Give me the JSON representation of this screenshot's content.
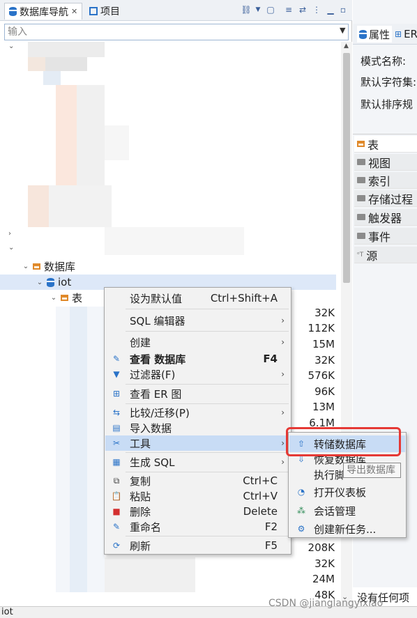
{
  "nav_tabs": {
    "navigator": "数据库导航",
    "projects": "项目"
  },
  "filter": {
    "placeholder": "输入"
  },
  "tree": {
    "databases_folder": "数据库",
    "db_name": "iot",
    "tables_folder": "表"
  },
  "sizes": [
    "32K",
    "112K",
    "15M",
    "32K",
    "576K",
    "96K",
    "13M",
    "6.1M",
    "208K",
    "32K",
    "24M",
    "48K"
  ],
  "right_panel": {
    "tab_properties": "属性",
    "tab_er": "ER",
    "schema_name_label": "模式名称:",
    "default_charset_label": "默认字符集:",
    "default_collation_label": "默认排序规",
    "categories": [
      "表",
      "视图",
      "索引",
      "存储过程",
      "触发器",
      "事件",
      "源"
    ],
    "empty_text": "没有任何项"
  },
  "context_menu": {
    "items": [
      {
        "label": "设为默认值",
        "shortcut": "Ctrl+Shift+A"
      },
      {
        "label": "SQL 编辑器",
        "submenu": true
      },
      {
        "label": "创建",
        "submenu": true
      },
      {
        "label": "查看 数据库",
        "shortcut": "F4"
      },
      {
        "label": "过滤器(F)",
        "submenu": true
      },
      {
        "label": "查看 ER 图"
      },
      {
        "label": "比较/迁移(P)",
        "submenu": true
      },
      {
        "label": "导入数据"
      },
      {
        "label": "工具",
        "submenu": true
      },
      {
        "label": "生成 SQL",
        "submenu": true
      },
      {
        "label": "复制",
        "shortcut": "Ctrl+C"
      },
      {
        "label": "粘贴",
        "shortcut": "Ctrl+V"
      },
      {
        "label": "删除",
        "shortcut": "Delete"
      },
      {
        "label": "重命名",
        "shortcut": "F2"
      },
      {
        "label": "刷新",
        "shortcut": "F5"
      }
    ]
  },
  "tools_submenu": {
    "items": [
      "转储数据库",
      "恢复数据库",
      "执行脚",
      "打开仪表板",
      "会话管理",
      "创建新任务..."
    ]
  },
  "tooltip": "导出数据库",
  "status_text": "iot",
  "watermark": "CSDN @jianglangyixiao",
  "colors": {
    "highlight": "#c8dcf5",
    "annotation_red": "#e53935",
    "db_icon_blue": "#2a73c8",
    "table_icon_orange": "#e0892a"
  }
}
